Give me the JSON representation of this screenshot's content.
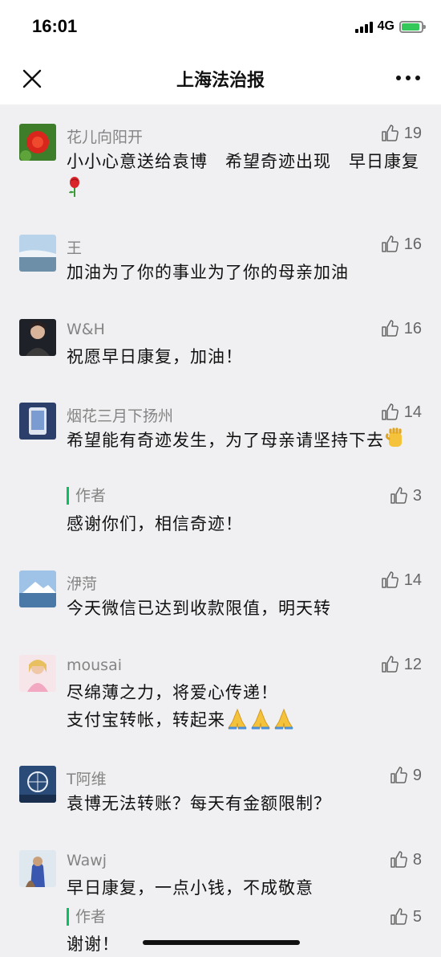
{
  "status_bar": {
    "time": "16:01",
    "network": "4G"
  },
  "nav": {
    "title": "上海法治报"
  },
  "colors": {
    "accent": "#07c160",
    "background": "#f0f0f2",
    "nick": "#848484"
  },
  "comments": [
    {
      "nick": "花儿向阳开",
      "likes": "19",
      "text": "小小心意送给袁博　希望奇迹出现　早日康复"
    },
    {
      "nick": "王",
      "likes": "16",
      "text": "加油为了你的事业为了你的母亲加油"
    },
    {
      "nick": "W&H",
      "likes": "16",
      "text": "祝愿早日康复，加油！"
    },
    {
      "nick": "烟花三月下扬州",
      "likes": "14",
      "text": "希望能有奇迹发生，为了母亲请坚持下去",
      "reply": {
        "label": "作者",
        "likes": "3",
        "text": "感谢你们，相信奇迹！"
      }
    },
    {
      "nick": "洢菏",
      "likes": "14",
      "text": "今天微信已达到收款限值，明天转"
    },
    {
      "nick": "mousai",
      "likes": "12",
      "text_line1": "尽绵薄之力，将爱心传递！",
      "text_line2": "支付宝转帐，转起来"
    },
    {
      "nick": "T阿维",
      "likes": "9",
      "text": "袁博无法转账？每天有金额限制？"
    },
    {
      "nick": "Wawj",
      "likes": "8",
      "text": "早日康复，一点小钱，不成敬意",
      "reply": {
        "label": "作者",
        "likes": "5",
        "text": "谢谢！"
      }
    }
  ]
}
